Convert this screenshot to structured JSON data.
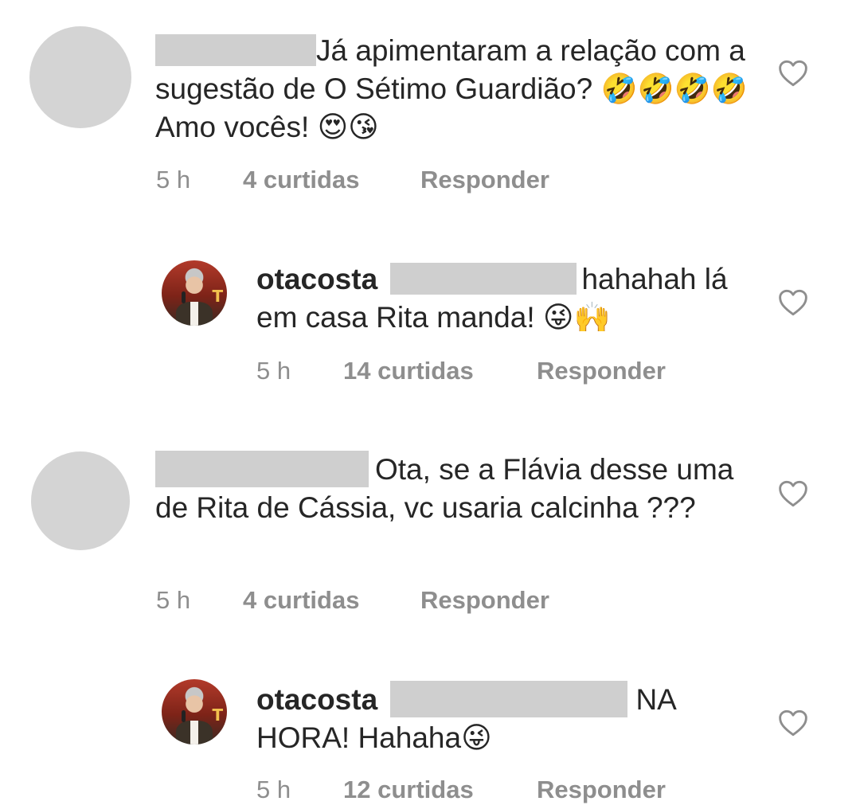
{
  "comments": [
    {
      "text": "Já apimentaram a relação com a sugestão de O Sétimo Guardião? 🤣🤣🤣🤣 Amo vocês! 😍😘",
      "time": "5 h",
      "likes": "4 curtidas",
      "reply": "Responder"
    },
    {
      "username": "otacosta",
      "text_after": "hahahah lá em casa Rita manda! 😜🙌",
      "time": "5 h",
      "likes": "14 curtidas",
      "reply": "Responder"
    },
    {
      "text": "Ota, se a Flávia desse uma de Rita de Cássia, vc usaria calcinha ???",
      "time": "5 h",
      "likes": "4 curtidas",
      "reply": "Responder"
    },
    {
      "username": "otacosta",
      "text_after": "NA HORA! Hahaha😜",
      "time": "5 h",
      "likes": "12 curtidas",
      "reply": "Responder"
    }
  ],
  "icons": {
    "like": "heart-outline-icon"
  },
  "colors": {
    "text": "#262626",
    "meta": "#8e8e8e",
    "redaction": "#cfcfcf",
    "avatar_placeholder": "#d4d4d4"
  }
}
